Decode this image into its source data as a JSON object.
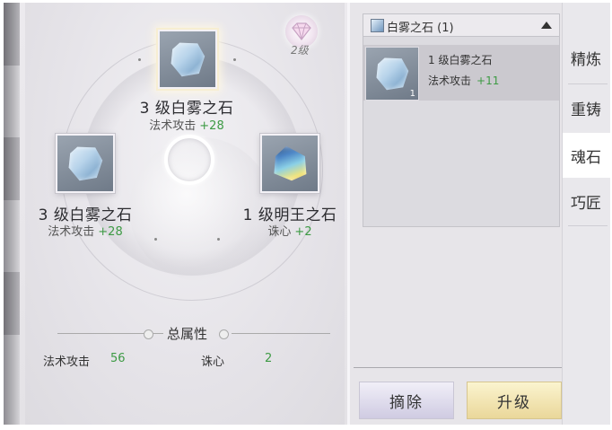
{
  "sockets": {
    "top": {
      "name": "3 级白雾之石",
      "attr_label": "法术攻击",
      "attr_value": "+28",
      "icon": "white-mist-stone-icon"
    },
    "left": {
      "name": "3 级白雾之石",
      "attr_label": "法术攻击",
      "attr_value": "+28",
      "icon": "white-mist-stone-icon"
    },
    "right": {
      "name": "1 级明王之石",
      "attr_label": "诛心",
      "attr_value": "+2",
      "icon": "ming-wang-stone-icon"
    }
  },
  "level_badge": {
    "text": "2级",
    "icon": "diamond-crown-icon"
  },
  "total_attributes": {
    "title": "总属性",
    "stats": [
      {
        "label": "法术攻击",
        "value": "56"
      },
      {
        "label": "诛心",
        "value": "2"
      }
    ]
  },
  "stone_list": {
    "header": "白雾之石 (1)",
    "items": [
      {
        "name": "1 级白雾之石",
        "attr_label": "法术攻击",
        "attr_value": "+11",
        "count": "1"
      }
    ]
  },
  "buttons": {
    "remove": "摘除",
    "upgrade": "升级"
  },
  "tabs": [
    {
      "label": "精炼",
      "active": false
    },
    {
      "label": "重铸",
      "active": false
    },
    {
      "label": "魂石",
      "active": true
    },
    {
      "label": "巧匠",
      "active": false
    }
  ],
  "colors": {
    "bonus_green": "#3d9a44",
    "upgrade_gold": "#ead79a",
    "remove_lavender": "#cfcbe2"
  }
}
